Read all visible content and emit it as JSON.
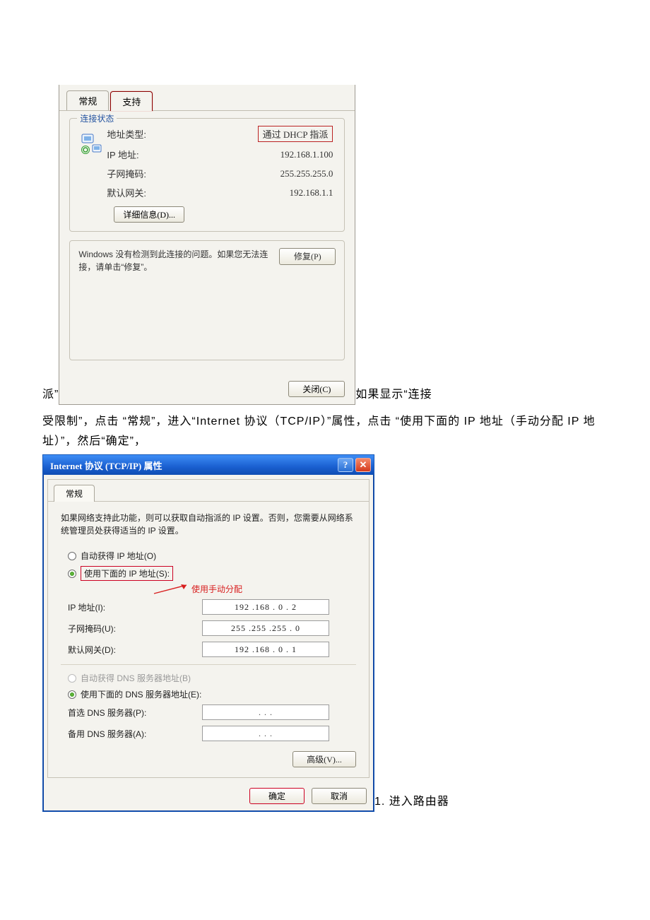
{
  "doc": {
    "line0_prefix": "派”",
    "line0_suffix": "如果显示“连接",
    "line1": "受限制”，点击 “常规”，进入“Internet 协议（TCP/IP）”属性，点击 “使用下面的 IP 地址（手动分配 IP 地址）”，然后“确定”，",
    "after_dlg2": "1. 进入路由器"
  },
  "dlg1": {
    "tabs": {
      "general": "常规",
      "support": "支持"
    },
    "legend": "连接状态",
    "rows": {
      "addr_type_label": "地址类型:",
      "addr_type_value": "通过 DHCP 指派",
      "ip_label": "IP 地址:",
      "ip_value": "192.168.1.100",
      "mask_label": "子网掩码:",
      "mask_value": "255.255.255.0",
      "gw_label": "默认网关:",
      "gw_value": "192.168.1.1"
    },
    "details_btn": "详细信息(D)...",
    "repair_text": "Windows 没有检测到此连接的问题。如果您无法连接，请单击“修复”。",
    "repair_btn": "修复(P)",
    "close_btn": "关闭(C)"
  },
  "dlg2": {
    "title": "Internet 协议 (TCP/IP) 属性",
    "tab": "常规",
    "desc": "如果网络支持此功能，则可以获取自动指派的 IP 设置。否则，您需要从网络系统管理员处获得适当的 IP 设置。",
    "radio_auto_ip": "自动获得 IP 地址(O)",
    "radio_manual_ip": "使用下面的 IP 地址(S):",
    "annotation": "使用手动分配",
    "ip_rows": {
      "ip_label": "IP 地址(I):",
      "ip_value": "192 .168 . 0 . 2",
      "mask_label": "子网掩码(U):",
      "mask_value": "255 .255 .255 . 0",
      "gw_label": "默认网关(D):",
      "gw_value": "192 .168 . 0 . 1"
    },
    "radio_auto_dns": "自动获得 DNS 服务器地址(B)",
    "radio_manual_dns": "使用下面的 DNS 服务器地址(E):",
    "dns_rows": {
      "pref_label": "首选 DNS 服务器(P):",
      "pref_value": ".   .   .",
      "alt_label": "备用 DNS 服务器(A):",
      "alt_value": ".   .   ."
    },
    "advanced_btn": "高级(V)...",
    "ok_btn": "确定",
    "cancel_btn": "取消"
  }
}
